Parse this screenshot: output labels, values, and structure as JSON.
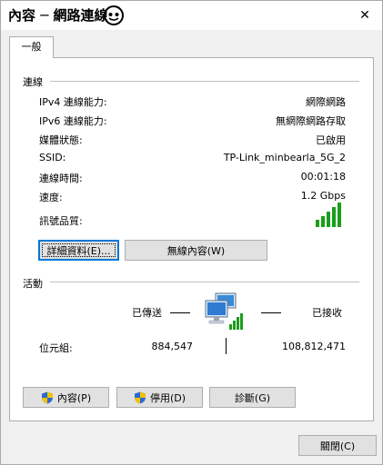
{
  "window": {
    "title": "內容 ─ 網路連線",
    "close_glyph": "✕"
  },
  "tabs": [
    {
      "label": "一般"
    }
  ],
  "connection": {
    "heading": "連線",
    "rows": [
      {
        "label": "IPv4 連線能力:",
        "value": "網際網路"
      },
      {
        "label": "IPv6 連線能力:",
        "value": "無網際網路存取"
      },
      {
        "label": "媒體狀態:",
        "value": "已啟用"
      },
      {
        "label": "SSID:",
        "value": "TP-Link_minbearla_5G_2"
      },
      {
        "label": "連線時間:",
        "value": "00:01:18"
      },
      {
        "label": "速度:",
        "value": "1.2 Gbps"
      },
      {
        "label": "訊號品質:",
        "value": ""
      }
    ],
    "signal_bars": 5,
    "signal_color": "#1a9e1a",
    "details_button": "詳細資料(E)...",
    "wireless_button": "無線內容(W)"
  },
  "activity": {
    "heading": "活動",
    "sent_label": "已傳送",
    "received_label": "已接收",
    "bytes_label": "位元組:",
    "bytes_sent": "884,547",
    "bytes_received": "108,812,471"
  },
  "actions": {
    "properties_button": "內容(P)",
    "disable_button": "停用(D)",
    "diagnose_button": "診斷(G)"
  },
  "footer": {
    "close_button": "關閉(C)"
  },
  "colors": {
    "accent": "#0078d7",
    "shield_blue": "#2a6bd1",
    "shield_yellow": "#f2c200"
  }
}
